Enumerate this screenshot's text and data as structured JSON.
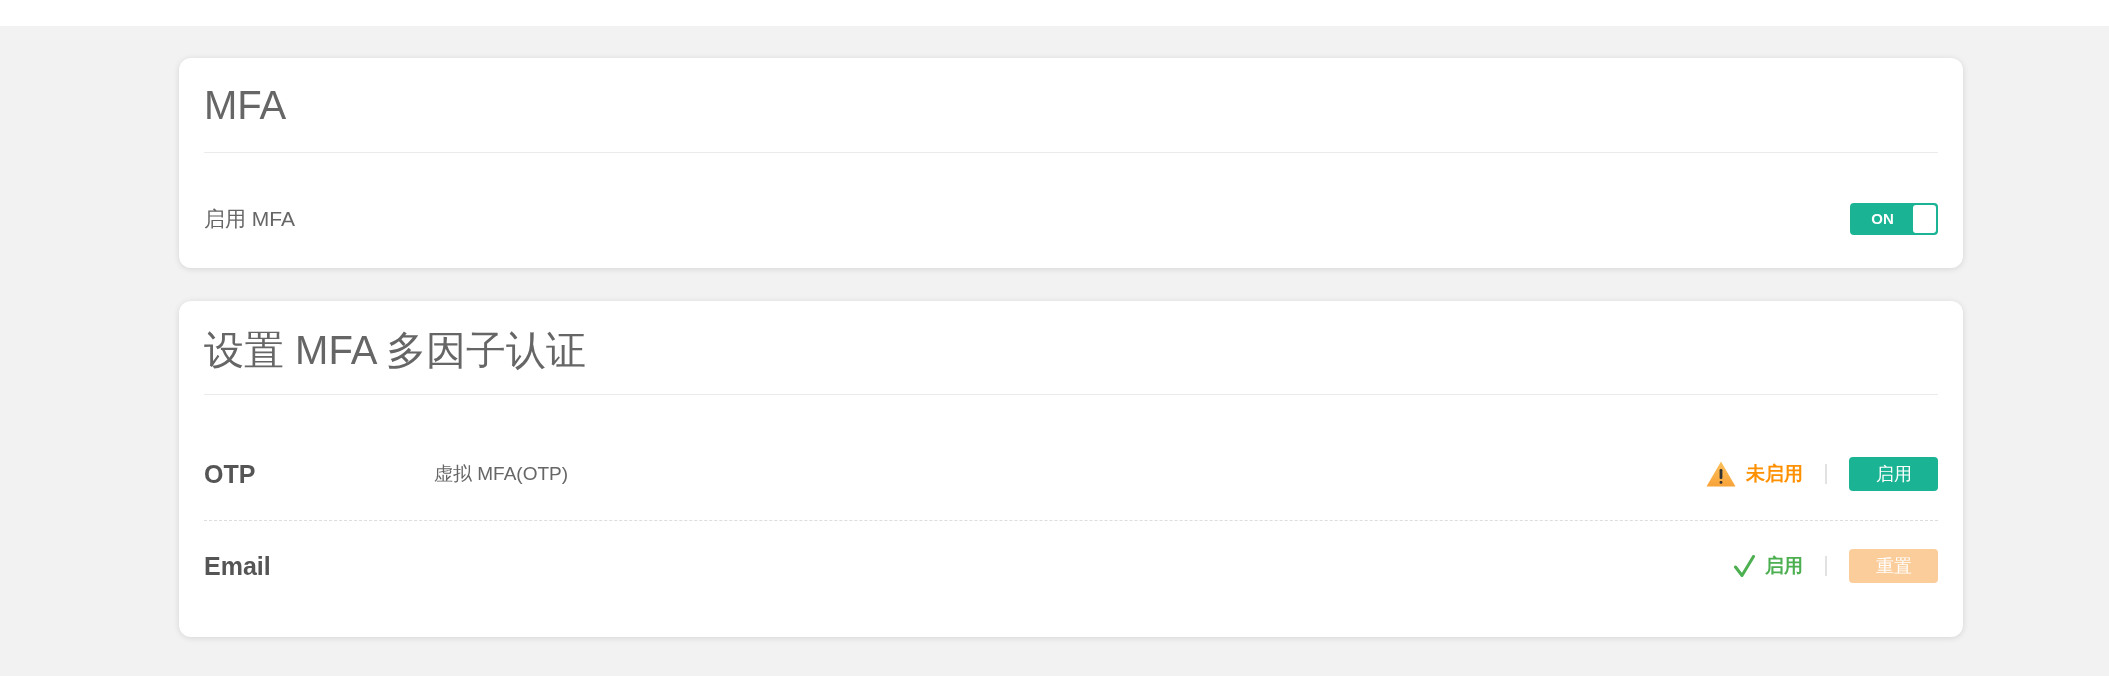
{
  "mfa_card": {
    "title": "MFA",
    "setting": {
      "label": "启用 MFA",
      "toggle": {
        "label": "ON",
        "on": true
      }
    }
  },
  "methods_card": {
    "title": "设置 MFA 多因子认证",
    "methods": [
      {
        "name": "OTP",
        "description": "虚拟 MFA(OTP)",
        "status": {
          "kind": "warning",
          "text": "未启用"
        },
        "button": {
          "label": "启用",
          "kind": "primary",
          "disabled": false
        }
      },
      {
        "name": "Email",
        "status": {
          "kind": "ok",
          "text": "启用"
        },
        "button": {
          "label": "重置",
          "kind": "warning",
          "disabled": true
        }
      }
    ]
  }
}
